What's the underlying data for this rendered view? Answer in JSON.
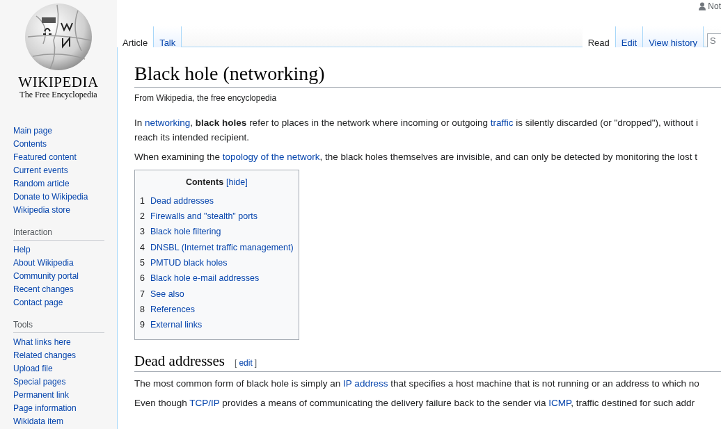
{
  "user_link": "Not",
  "logo": {
    "wordmark": "WIKIPEDIA",
    "tagline": "The Free Encyclopedia"
  },
  "nav_main": [
    "Main page",
    "Contents",
    "Featured content",
    "Current events",
    "Random article",
    "Donate to Wikipedia",
    "Wikipedia store"
  ],
  "nav_sections": [
    {
      "heading": "Interaction",
      "items": [
        "Help",
        "About Wikipedia",
        "Community portal",
        "Recent changes",
        "Contact page"
      ]
    },
    {
      "heading": "Tools",
      "items": [
        "What links here",
        "Related changes",
        "Upload file",
        "Special pages",
        "Permanent link",
        "Page information",
        "Wikidata item"
      ]
    }
  ],
  "left_tabs": [
    {
      "label": "Article",
      "selected": true
    },
    {
      "label": "Talk",
      "selected": false
    }
  ],
  "right_tabs": [
    {
      "label": "Read",
      "selected": true
    },
    {
      "label": "Edit",
      "selected": false
    },
    {
      "label": "View history",
      "selected": false
    }
  ],
  "search": {
    "placeholder": "S"
  },
  "title": "Black hole (networking)",
  "subtitle": "From Wikipedia, the free encyclopedia",
  "intro": [
    [
      {
        "kind": "text",
        "text": "In "
      },
      {
        "kind": "link",
        "text": "networking"
      },
      {
        "kind": "text",
        "text": ", "
      },
      {
        "kind": "bold",
        "text": "black holes"
      },
      {
        "kind": "text",
        "text": " refer to places in the network where incoming or outgoing "
      },
      {
        "kind": "link",
        "text": "traffic"
      },
      {
        "kind": "text",
        "text": " is silently discarded (or \"dropped\"), without i"
      },
      {
        "kind": "break"
      },
      {
        "kind": "text",
        "text": "reach its intended recipient."
      }
    ],
    [
      {
        "kind": "text",
        "text": "When examining the "
      },
      {
        "kind": "link",
        "text": "topology of the network"
      },
      {
        "kind": "text",
        "text": ", the black holes themselves are invisible, and can only be detected by monitoring the lost t"
      }
    ]
  ],
  "toc": {
    "title": "Contents",
    "toggle": "[hide]",
    "items": [
      {
        "number": "1",
        "label": "Dead addresses"
      },
      {
        "number": "2",
        "label": "Firewalls and \"stealth\" ports"
      },
      {
        "number": "3",
        "label": "Black hole filtering"
      },
      {
        "number": "4",
        "label": "DNSBL (Internet traffic management)"
      },
      {
        "number": "5",
        "label": "PMTUD black holes"
      },
      {
        "number": "6",
        "label": "Black hole e-mail addresses"
      },
      {
        "number": "7",
        "label": "See also"
      },
      {
        "number": "8",
        "label": "References"
      },
      {
        "number": "9",
        "label": "External links"
      }
    ]
  },
  "section": {
    "heading": "Dead addresses",
    "edit_open": "[",
    "edit": "edit",
    "edit_close": "]",
    "paragraphs": [
      [
        {
          "kind": "text",
          "text": "The most common form of black hole is simply an "
        },
        {
          "kind": "link",
          "text": "IP address"
        },
        {
          "kind": "text",
          "text": " that specifies a host machine that is not running or an address to which no"
        }
      ],
      [
        {
          "kind": "text",
          "text": "Even though "
        },
        {
          "kind": "link",
          "text": "TCP/IP"
        },
        {
          "kind": "text",
          "text": " provides a means of communicating the delivery failure back to the sender via "
        },
        {
          "kind": "link",
          "text": "ICMP"
        },
        {
          "kind": "text",
          "text": ", traffic destined for such addr"
        }
      ]
    ]
  }
}
